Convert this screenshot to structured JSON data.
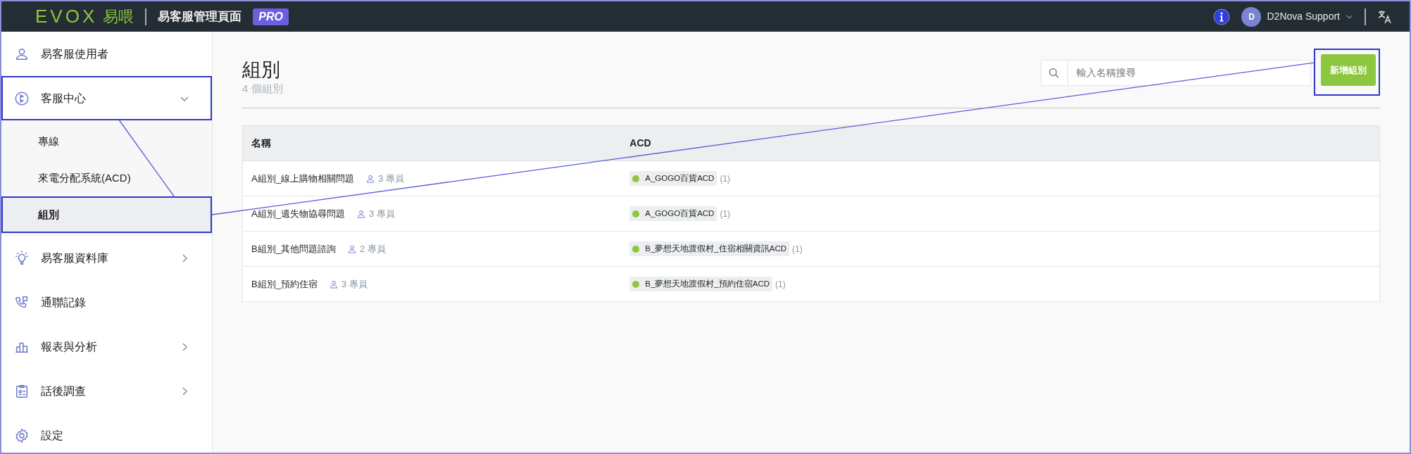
{
  "header": {
    "logo": "EVOX",
    "logo_suffix": "易喂",
    "title": "易客服管理頁面",
    "badge": "PRO",
    "user": {
      "initial": "D",
      "name": "D2Nova Support"
    }
  },
  "sidebar": {
    "items": [
      {
        "label": "易客服使用者",
        "kind": "link",
        "highlighted": false
      },
      {
        "label": "客服中心",
        "kind": "group",
        "expanded": true,
        "highlighted": true,
        "children": [
          {
            "label": "專線",
            "selected": false,
            "highlighted": false
          },
          {
            "label": "來電分配系統(ACD)",
            "selected": false,
            "highlighted": false
          },
          {
            "label": "組別",
            "selected": true,
            "highlighted": true
          }
        ]
      },
      {
        "label": "易客服資料庫",
        "kind": "group",
        "expanded": false,
        "highlighted": false
      },
      {
        "label": "通聯記錄",
        "kind": "link",
        "highlighted": false
      },
      {
        "label": "報表與分析",
        "kind": "group",
        "expanded": false,
        "highlighted": false
      },
      {
        "label": "話後調查",
        "kind": "group",
        "expanded": false,
        "highlighted": false
      },
      {
        "label": "設定",
        "kind": "link",
        "highlighted": false
      }
    ]
  },
  "page": {
    "title": "組別",
    "subtitle": "4 個組別",
    "search": {
      "placeholder": "輸入名稱搜尋"
    },
    "add_button": {
      "label": "新增組別",
      "highlighted": true
    }
  },
  "table": {
    "columns": [
      "名稱",
      "ACD"
    ],
    "rows": [
      {
        "name": "A組別_線上購物相關問題",
        "members": "3 專員",
        "acd": {
          "name": "A_GOGO百貨ACD",
          "count": "(1)",
          "color": "#8dc63f"
        }
      },
      {
        "name": "A組別_遺失物協尋問題",
        "members": "3 專員",
        "acd": {
          "name": "A_GOGO百貨ACD",
          "count": "(1)",
          "color": "#8dc63f"
        }
      },
      {
        "name": "B組別_其他問題諮詢",
        "members": "2 專員",
        "acd": {
          "name": "B_夢想天地渡假村_住宿相關資訊ACD",
          "count": "(1)",
          "color": "#8dc63f"
        }
      },
      {
        "name": "B組別_預約住宿",
        "members": "3 專員",
        "acd": {
          "name": "B_夢想天地渡假村_預約住宿ACD",
          "count": "(1)",
          "color": "#8dc63f"
        }
      }
    ]
  }
}
